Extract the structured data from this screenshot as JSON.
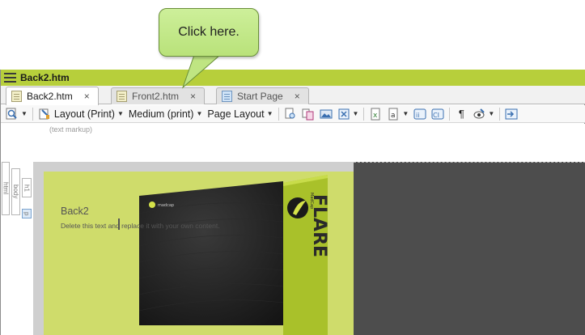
{
  "callout": {
    "text": "Click here."
  },
  "window": {
    "title": "Back2.htm"
  },
  "tabs": [
    {
      "label": "Back2.htm",
      "close": "×",
      "active": true
    },
    {
      "label": "Front2.htm",
      "close": "×",
      "active": false
    },
    {
      "label": "Start Page",
      "close": "×",
      "active": false
    }
  ],
  "toolbar": {
    "layout_label": "Layout (Print)",
    "medium_label": "Medium (print)",
    "page_layout_label": "Page Layout"
  },
  "markup": {
    "text": "(text markup)"
  },
  "structure_bars": [
    "html",
    "body",
    "h1",
    "p"
  ],
  "page": {
    "heading": "Back2",
    "body": "Delete this text and replace it with your own content."
  },
  "box_art": {
    "logo_small": "madcap",
    "product_word": "FLARE",
    "brand": "MadCap"
  },
  "colors": {
    "accent": "#b7cf3b",
    "callout": "#c6eb8c",
    "page_bg": "#cfdc6b",
    "dark_bg": "#4d4d4d"
  }
}
